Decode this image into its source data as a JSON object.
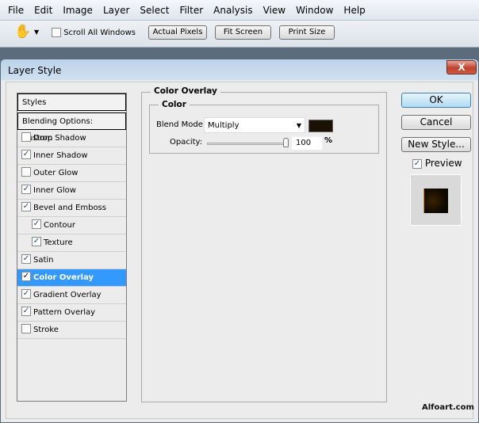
{
  "menu": [
    "File",
    "Edit",
    "Image",
    "Layer",
    "Select",
    "Filter",
    "Analysis",
    "View",
    "Window",
    "Help"
  ],
  "toolbar": {
    "tool_icon": "hand-icon",
    "scroll_all": "Scroll All Windows",
    "scroll_all_checked": false,
    "actual_pixels": "Actual Pixels",
    "fit_screen": "Fit Screen",
    "print_size": "Print Size"
  },
  "dialog": {
    "title": "Layer Style",
    "close": "X",
    "list": {
      "header": "Styles",
      "blending": "Blending Options: Custom",
      "items": [
        {
          "label": "Drop Shadow",
          "checked": false
        },
        {
          "label": "Inner Shadow",
          "checked": true
        },
        {
          "label": "Outer Glow",
          "checked": false
        },
        {
          "label": "Inner Glow",
          "checked": true
        },
        {
          "label": "Bevel and Emboss",
          "checked": true
        },
        {
          "label": "Contour",
          "checked": true,
          "sub": true
        },
        {
          "label": "Texture",
          "checked": true,
          "sub": true
        },
        {
          "label": "Satin",
          "checked": true
        },
        {
          "label": "Color Overlay",
          "checked": true,
          "selected": true
        },
        {
          "label": "Gradient Overlay",
          "checked": true
        },
        {
          "label": "Pattern Overlay",
          "checked": true
        },
        {
          "label": "Stroke",
          "checked": false
        }
      ]
    },
    "panel": {
      "title": "Color Overlay",
      "group": "Color",
      "blend_label": "Blend Mode:",
      "blend_value": "Multiply",
      "color": "#1a1205",
      "opacity_label": "Opacity:",
      "opacity_value": "100",
      "opacity_unit": "%",
      "opacity_percent": 100
    },
    "buttons": {
      "ok": "OK",
      "cancel": "Cancel",
      "new_style": "New Style..."
    },
    "preview": {
      "label": "Preview",
      "checked": true
    }
  },
  "watermark": "Alfoart.com",
  "colors": {
    "selection": "#3399ff"
  }
}
